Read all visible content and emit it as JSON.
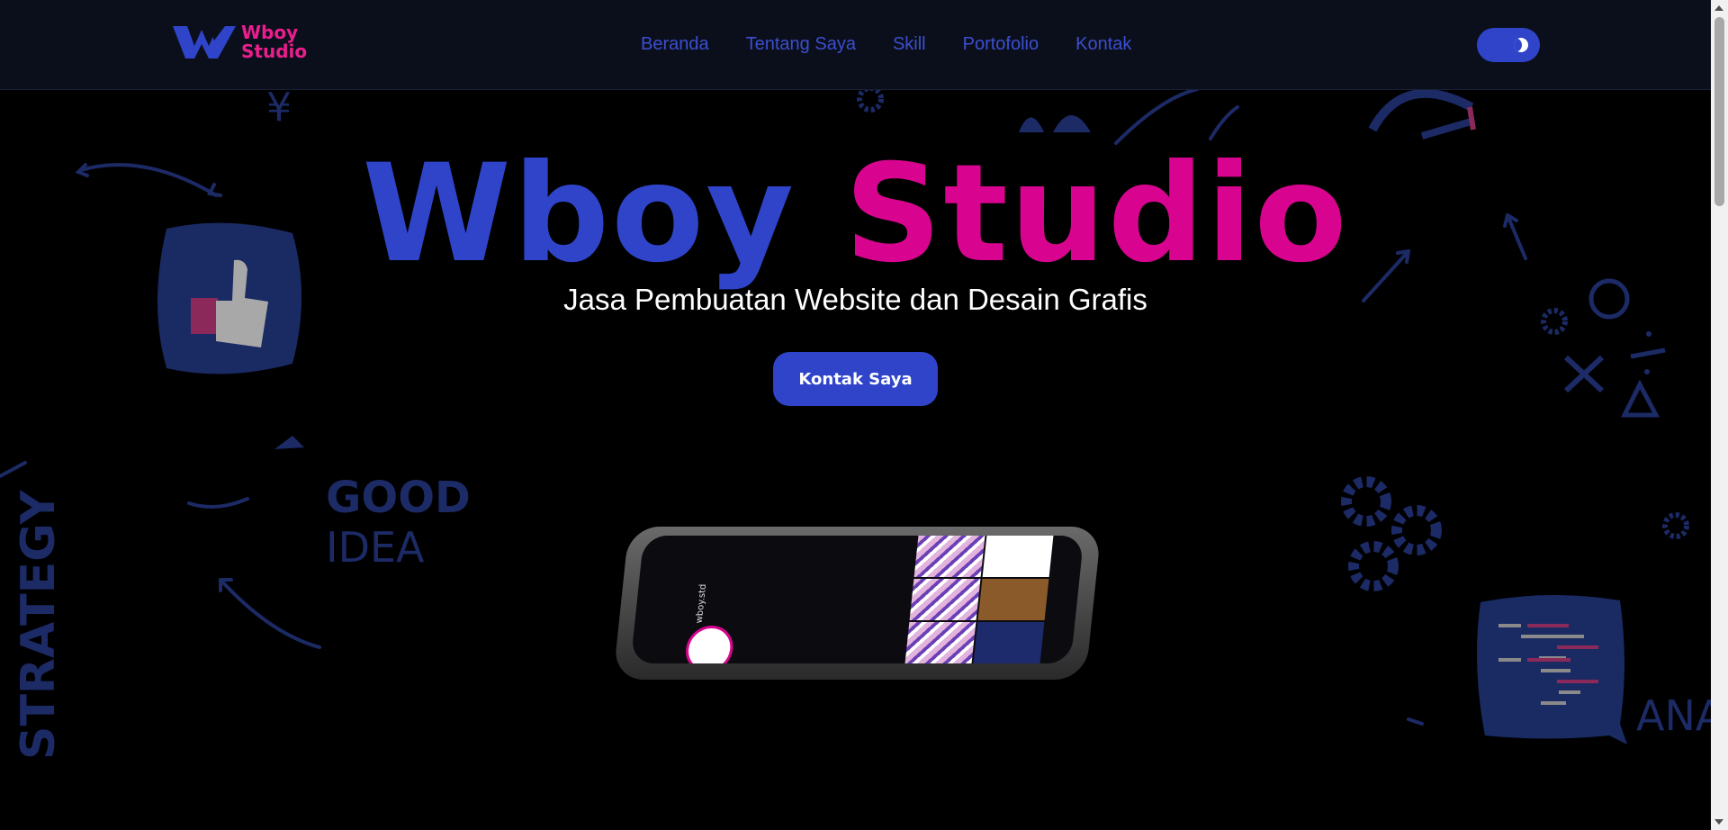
{
  "header": {
    "logo_text_line1": "Wboy",
    "logo_text_line2": "Studio",
    "nav": [
      "Beranda",
      "Tentang Saya",
      "Skill",
      "Portofolio",
      "Kontak"
    ]
  },
  "hero": {
    "title_part1": "Wboy",
    "title_part2": "Studio",
    "subtitle": "Jasa Pembuatan Website dan Desain Grafis",
    "cta_label": "Kontak Saya"
  },
  "phone": {
    "handle": "wboy.std"
  },
  "colors": {
    "accent_blue": "#2f44c9",
    "accent_pink": "#d8048f",
    "header_bg": "#0b0f1c",
    "doodle_blue": "#1c2a66"
  },
  "icons": [
    "logo-w-icon",
    "dark-mode-toggle",
    "moon-icon",
    "thumbs-up-icon",
    "gear-icon",
    "arrow-icon",
    "code-bubble-icon"
  ]
}
